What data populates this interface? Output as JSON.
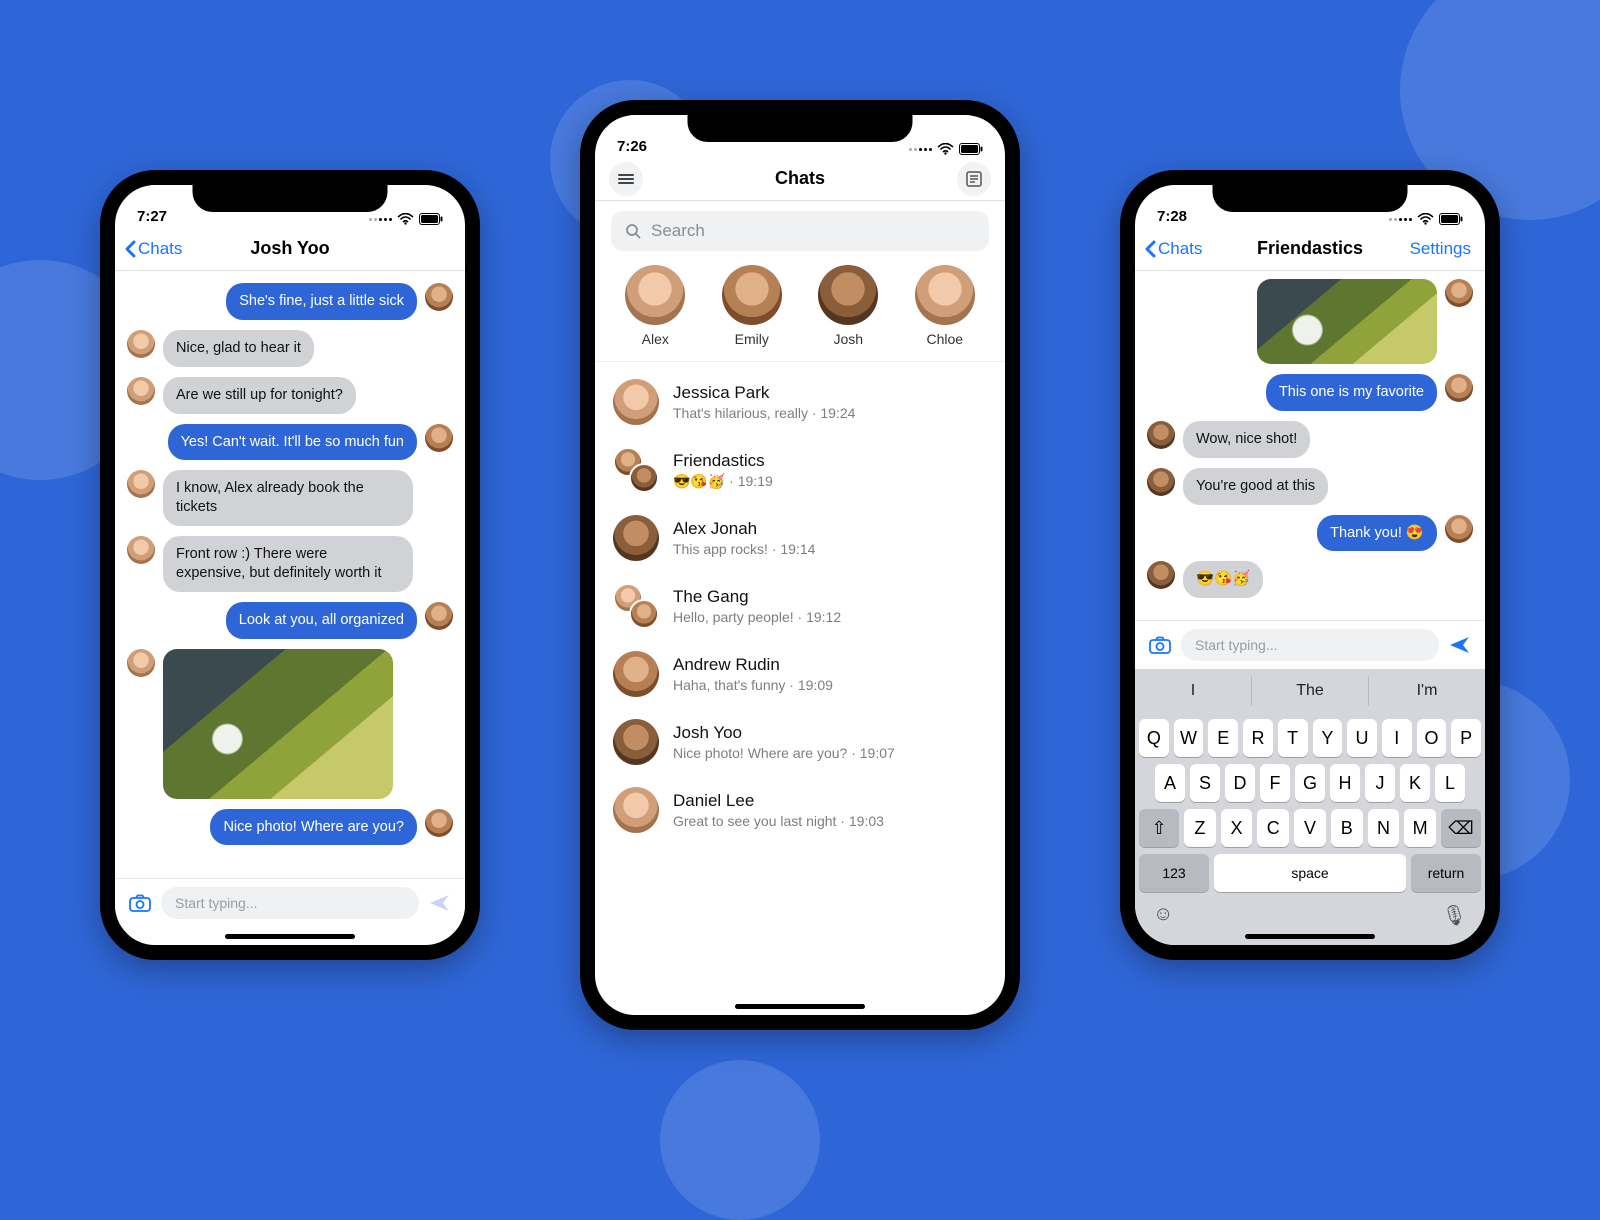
{
  "colors": {
    "accent": "#1776ff",
    "bubble_out": "#2f66d7",
    "bubble_in": "#d0d2d6"
  },
  "phone_left": {
    "status_time": "7:27",
    "nav_back": "Chats",
    "nav_title": "Josh Yoo",
    "composer_placeholder": "Start typing...",
    "messages": [
      {
        "side": "out",
        "text": "She's fine, just a little sick"
      },
      {
        "side": "in",
        "text": "Nice, glad to hear it"
      },
      {
        "side": "in",
        "text": "Are we still up for tonight?"
      },
      {
        "side": "out",
        "text": "Yes! Can't wait. It'll be so much fun"
      },
      {
        "side": "in",
        "text": "I know, Alex already book the tickets"
      },
      {
        "side": "in",
        "text": "Front row :) There were expensive, but definitely worth it"
      },
      {
        "side": "out",
        "text": "Look at you, all organized"
      },
      {
        "side": "in",
        "type": "image"
      },
      {
        "side": "out",
        "text": "Nice photo! Where are you?"
      }
    ]
  },
  "phone_center": {
    "status_time": "7:26",
    "nav_title": "Chats",
    "search_placeholder": "Search",
    "stories": [
      {
        "name": "Alex"
      },
      {
        "name": "Emily"
      },
      {
        "name": "Josh"
      },
      {
        "name": "Chloe"
      }
    ],
    "chats": [
      {
        "name": "Jessica Park",
        "preview": "That's hilarious, really",
        "time": "19:24",
        "type": "single"
      },
      {
        "name": "Friendastics",
        "preview": "😎😘🥳",
        "time": "19:19",
        "type": "group"
      },
      {
        "name": "Alex Jonah",
        "preview": "This app rocks!",
        "time": "19:14",
        "type": "single"
      },
      {
        "name": "The Gang",
        "preview": "Hello, party people!",
        "time": "19:12",
        "type": "group"
      },
      {
        "name": "Andrew Rudin",
        "preview": "Haha, that's funny",
        "time": "19:09",
        "type": "single"
      },
      {
        "name": "Josh Yoo",
        "preview": "Nice photo! Where are you?",
        "time": "19:07",
        "type": "single"
      },
      {
        "name": "Daniel Lee",
        "preview": "Great to see you last night",
        "time": "19:03",
        "type": "single"
      }
    ]
  },
  "phone_right": {
    "status_time": "7:28",
    "nav_back": "Chats",
    "nav_title": "Friendastics",
    "nav_right": "Settings",
    "composer_placeholder": "Start typing...",
    "messages": [
      {
        "side": "out",
        "type": "image"
      },
      {
        "side": "out",
        "text": "This one is my favorite"
      },
      {
        "side": "in",
        "text": "Wow, nice shot!"
      },
      {
        "side": "in",
        "text": "You're good at this"
      },
      {
        "side": "out",
        "text": "Thank you! 😍"
      },
      {
        "side": "in",
        "text": "😎😘🥳"
      }
    ],
    "suggestions": [
      "I",
      "The",
      "I'm"
    ],
    "keyboard": {
      "row1": [
        "Q",
        "W",
        "E",
        "R",
        "T",
        "Y",
        "U",
        "I",
        "O",
        "P"
      ],
      "row2": [
        "A",
        "S",
        "D",
        "F",
        "G",
        "H",
        "J",
        "K",
        "L"
      ],
      "row3": [
        "Z",
        "X",
        "C",
        "V",
        "B",
        "N",
        "M"
      ],
      "shift": "⇧",
      "backspace": "⌫",
      "numbers": "123",
      "space": "space",
      "return": "return",
      "emoji": "☺",
      "mic": "🎤"
    }
  }
}
